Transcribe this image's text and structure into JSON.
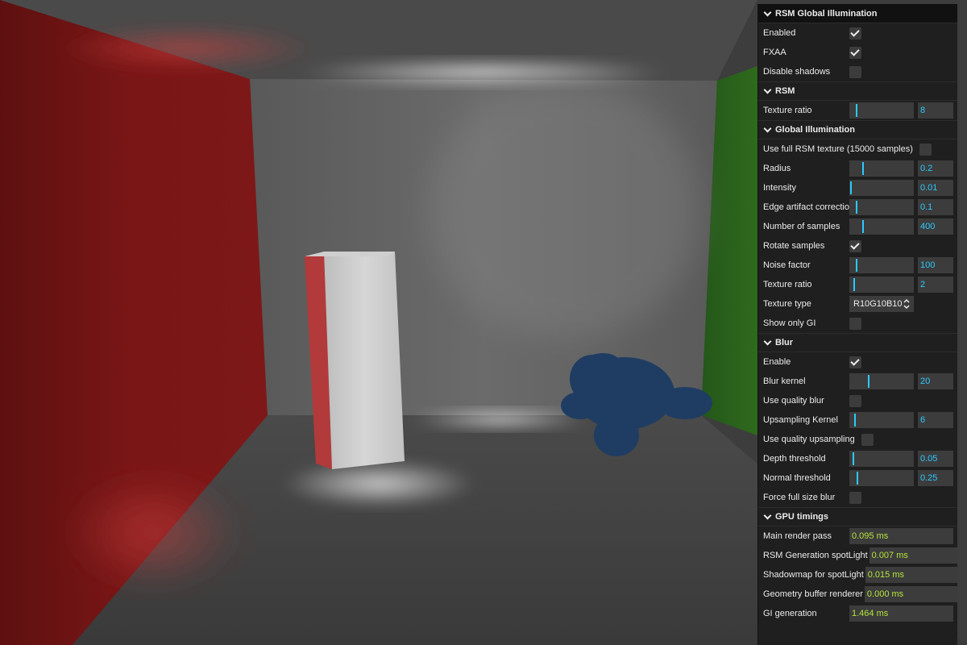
{
  "colors": {
    "accent": "#2cc9ff",
    "timing_value": "#b6e43a",
    "panel_bg": "#1f1f1f",
    "field_bg": "#3c3c3c",
    "wall_red": "#8a1a1a",
    "wall_green": "#2f6a1c",
    "monkey_blue": "#1f3d63"
  },
  "panel": {
    "root": {
      "title": "RSM Global Illumination",
      "enabled": {
        "label": "Enabled",
        "checked": true
      },
      "fxaa": {
        "label": "FXAA",
        "checked": true
      },
      "disable_shadows": {
        "label": "Disable shadows",
        "checked": false
      }
    },
    "rsm": {
      "title": "RSM",
      "texture_ratio": {
        "label": "Texture ratio",
        "value": "8",
        "fraction": 0.1
      }
    },
    "gi": {
      "title": "Global Illumination",
      "use_full_rsm": {
        "label": "Use full RSM texture (15000 samples)",
        "checked": false
      },
      "radius": {
        "label": "Radius",
        "value": "0.2",
        "fraction": 0.2
      },
      "intensity": {
        "label": "Intensity",
        "value": "0.01",
        "fraction": 0.01
      },
      "edge_artifact": {
        "label": "Edge artifact correction",
        "value": "0.1",
        "fraction": 0.1
      },
      "num_samples": {
        "label": "Number of samples",
        "value": "400",
        "fraction": 0.2
      },
      "rotate_samples": {
        "label": "Rotate samples",
        "checked": true
      },
      "noise_factor": {
        "label": "Noise factor",
        "value": "100",
        "fraction": 0.1
      },
      "texture_ratio": {
        "label": "Texture ratio",
        "value": "2",
        "fraction": 0.06
      },
      "texture_type": {
        "label": "Texture type",
        "value": "R10G10B10"
      },
      "show_only_gi": {
        "label": "Show only GI",
        "checked": false
      }
    },
    "blur": {
      "title": "Blur",
      "enable": {
        "label": "Enable",
        "checked": true
      },
      "blur_kernel": {
        "label": "Blur kernel",
        "value": "20",
        "fraction": 0.3
      },
      "use_quality_blur": {
        "label": "Use quality blur",
        "checked": false
      },
      "upsampling_kernel": {
        "label": "Upsampling Kernel",
        "value": "6",
        "fraction": 0.08
      },
      "use_quality_upsampling": {
        "label": "Use quality upsampling",
        "checked": false
      },
      "depth_threshold": {
        "label": "Depth threshold",
        "value": "0.05",
        "fraction": 0.05
      },
      "normal_threshold": {
        "label": "Normal threshold",
        "value": "0.25",
        "fraction": 0.12
      },
      "force_full_size_blur": {
        "label": "Force full size blur",
        "checked": false
      }
    },
    "gpu": {
      "title": "GPU timings",
      "main_render_pass": {
        "label": "Main render pass",
        "value": "0.095 ms"
      },
      "rsm_generation": {
        "label": "RSM Generation spotLight",
        "value": "0.007 ms"
      },
      "shadowmap": {
        "label": "Shadowmap for spotLight",
        "value": "0.015 ms"
      },
      "geometry_buffer": {
        "label": "Geometry buffer renderer",
        "value": "0.000 ms"
      },
      "gi_generation": {
        "label": "GI generation",
        "value": "1.464 ms"
      }
    }
  }
}
